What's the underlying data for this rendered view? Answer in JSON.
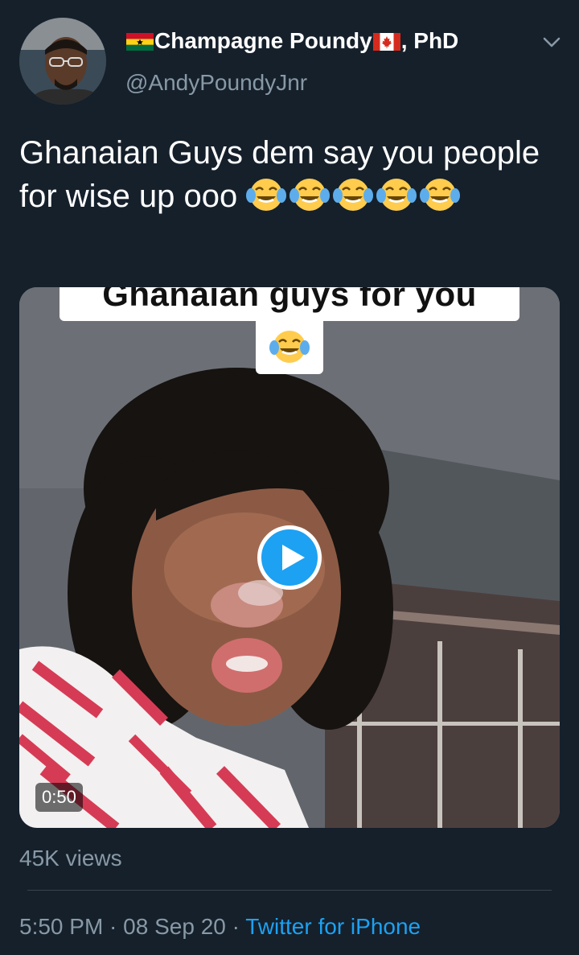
{
  "author": {
    "display_name": "Champagne Poundy",
    "display_suffix": ", PhD",
    "handle": "@AndyPoundyJnr"
  },
  "tweet": {
    "text": "Ghanaian Guys dem say you people for wise up ooo",
    "emoji_count": 5
  },
  "media": {
    "caption_overlay": "Ghanaian guys for you",
    "duration": "0:50"
  },
  "stats": {
    "views": "45K views"
  },
  "meta": {
    "time": "5:50 PM",
    "separator": " · ",
    "date": "08 Sep 20",
    "source": "Twitter for iPhone"
  },
  "colors": {
    "background": "#15202b",
    "text": "#ffffff",
    "muted": "#8899a6",
    "accent": "#1da1f2"
  },
  "icons": {
    "flag_1": "ghana-flag-icon",
    "flag_2": "canada-flag-icon",
    "caret": "chevron-down-icon",
    "emoji": "tears-of-joy-emoji",
    "play": "play-icon"
  }
}
